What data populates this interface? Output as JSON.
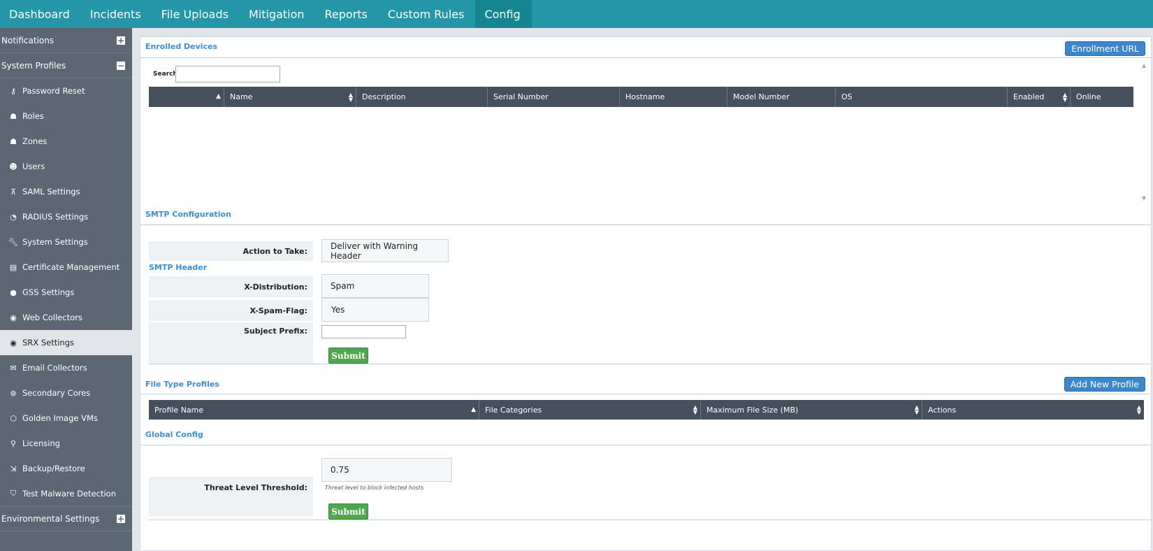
{
  "topnav": {
    "tabs": [
      "Dashboard",
      "Incidents",
      "File Uploads",
      "Mitigation",
      "Reports",
      "Custom Rules",
      "Config"
    ],
    "active": "Config"
  },
  "sidebar": {
    "notifications": "Notifications",
    "system_profiles": "System Profiles",
    "environmental_settings": "Environmental Settings",
    "items": [
      {
        "label": "Password Reset",
        "icon": "key-icon"
      },
      {
        "label": "Roles",
        "icon": "roles-icon"
      },
      {
        "label": "Zones",
        "icon": "zones-icon"
      },
      {
        "label": "Users",
        "icon": "users-icon"
      },
      {
        "label": "SAML Settings",
        "icon": "sitemap-icon"
      },
      {
        "label": "RADIUS Settings",
        "icon": "radius-icon"
      },
      {
        "label": "System Settings",
        "icon": "wrench-icon"
      },
      {
        "label": "Certificate Management",
        "icon": "certificate-icon"
      },
      {
        "label": "GSS Settings",
        "icon": "globe-icon"
      },
      {
        "label": "Web Collectors",
        "icon": "eye-icon"
      },
      {
        "label": "SRX Settings",
        "icon": "eye-icon"
      },
      {
        "label": "Email Collectors",
        "icon": "envelope-icon"
      },
      {
        "label": "Secondary Cores",
        "icon": "core-icon"
      },
      {
        "label": "Golden Image VMs",
        "icon": "cube-icon"
      },
      {
        "label": "Licensing",
        "icon": "ribbon-icon"
      },
      {
        "label": "Backup/Restore",
        "icon": "backup-icon"
      },
      {
        "label": "Test Malware Detection",
        "icon": "shield-icon"
      }
    ],
    "active": "SRX Settings"
  },
  "enrolled": {
    "title": "Enrolled Devices",
    "enroll_button": "Enrollment URL",
    "search_label": "Search:",
    "search_value": "",
    "columns": [
      "",
      "Name",
      "Description",
      "Serial Number",
      "Hostname",
      "Model Number",
      "OS",
      "Enabled",
      "Online"
    ]
  },
  "smtp": {
    "title": "SMTP Configuration",
    "action_label": "Action to Take:",
    "action_value": "Deliver with Warning Header",
    "header_title": "SMTP Header",
    "xdist_label": "X-Distribution:",
    "xdist_value": "Spam",
    "xspam_label": "X-Spam-Flag:",
    "xspam_value": "Yes",
    "subject_label": "Subject Prefix:",
    "subject_value": "",
    "submit": "Submit"
  },
  "filetype": {
    "title": "File Type Profiles",
    "add_button": "Add New Profile",
    "columns": [
      "Profile Name",
      "File Categories",
      "Maximum File Size (MB)",
      "Actions"
    ]
  },
  "global": {
    "title": "Global Config",
    "threshold_label": "Threat Level Threshold:",
    "threshold_value": "0.75",
    "threshold_hint": "Threat level to block infected hosts",
    "submit": "Submit"
  }
}
